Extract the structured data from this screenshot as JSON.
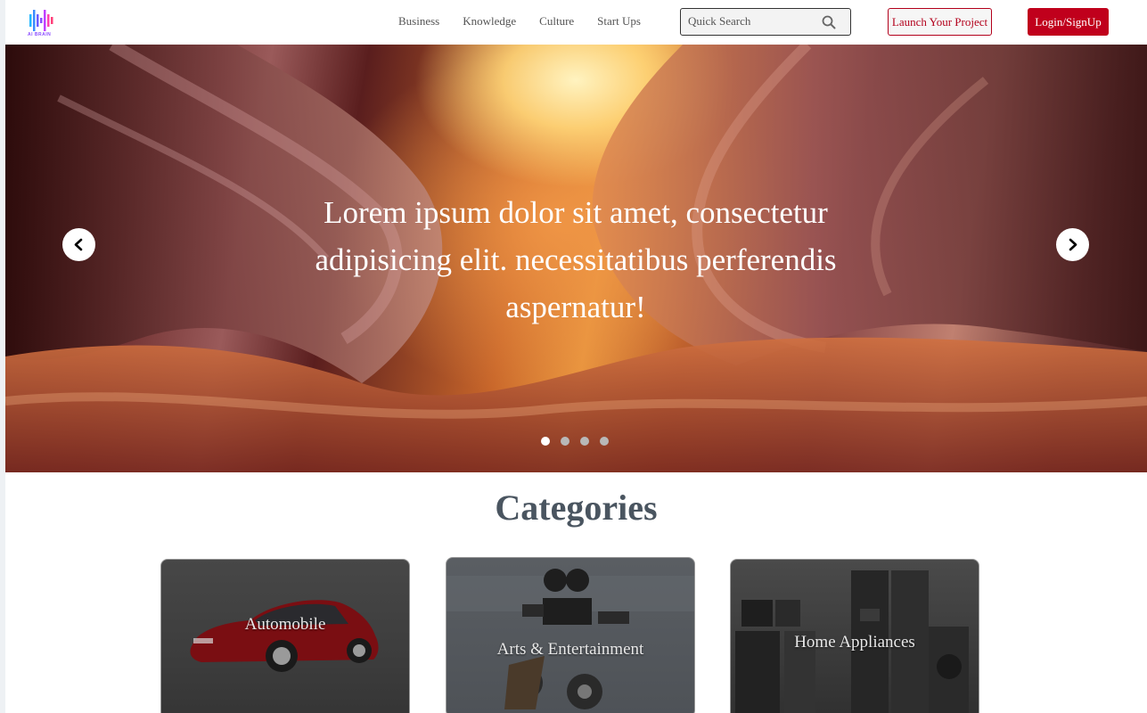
{
  "header": {
    "logo_text": "AI BRAIN",
    "nav": [
      {
        "label": "Business"
      },
      {
        "label": "Knowledge"
      },
      {
        "label": "Culture"
      },
      {
        "label": "Start Ups"
      }
    ],
    "search": {
      "placeholder": "Quick Search",
      "icon": "search-icon"
    },
    "launch_label": "Launch Your Project",
    "login_label": "Login/SignUp"
  },
  "hero": {
    "text": "Lorem ipsum dolor sit amet, consectetur adipisicing elit. necessitatibus perferendis aspernatur!",
    "prev_icon": "chevron-left-icon",
    "next_icon": "chevron-right-icon",
    "slide_count": 4,
    "active_slide": 1
  },
  "categories": {
    "title": "Categories",
    "items": [
      {
        "label": "Automobile"
      },
      {
        "label": "Arts & Entertainment"
      },
      {
        "label": "Home Appliances"
      }
    ]
  },
  "colors": {
    "brand_red": "#c0001c",
    "title_gray": "#4a5560"
  }
}
